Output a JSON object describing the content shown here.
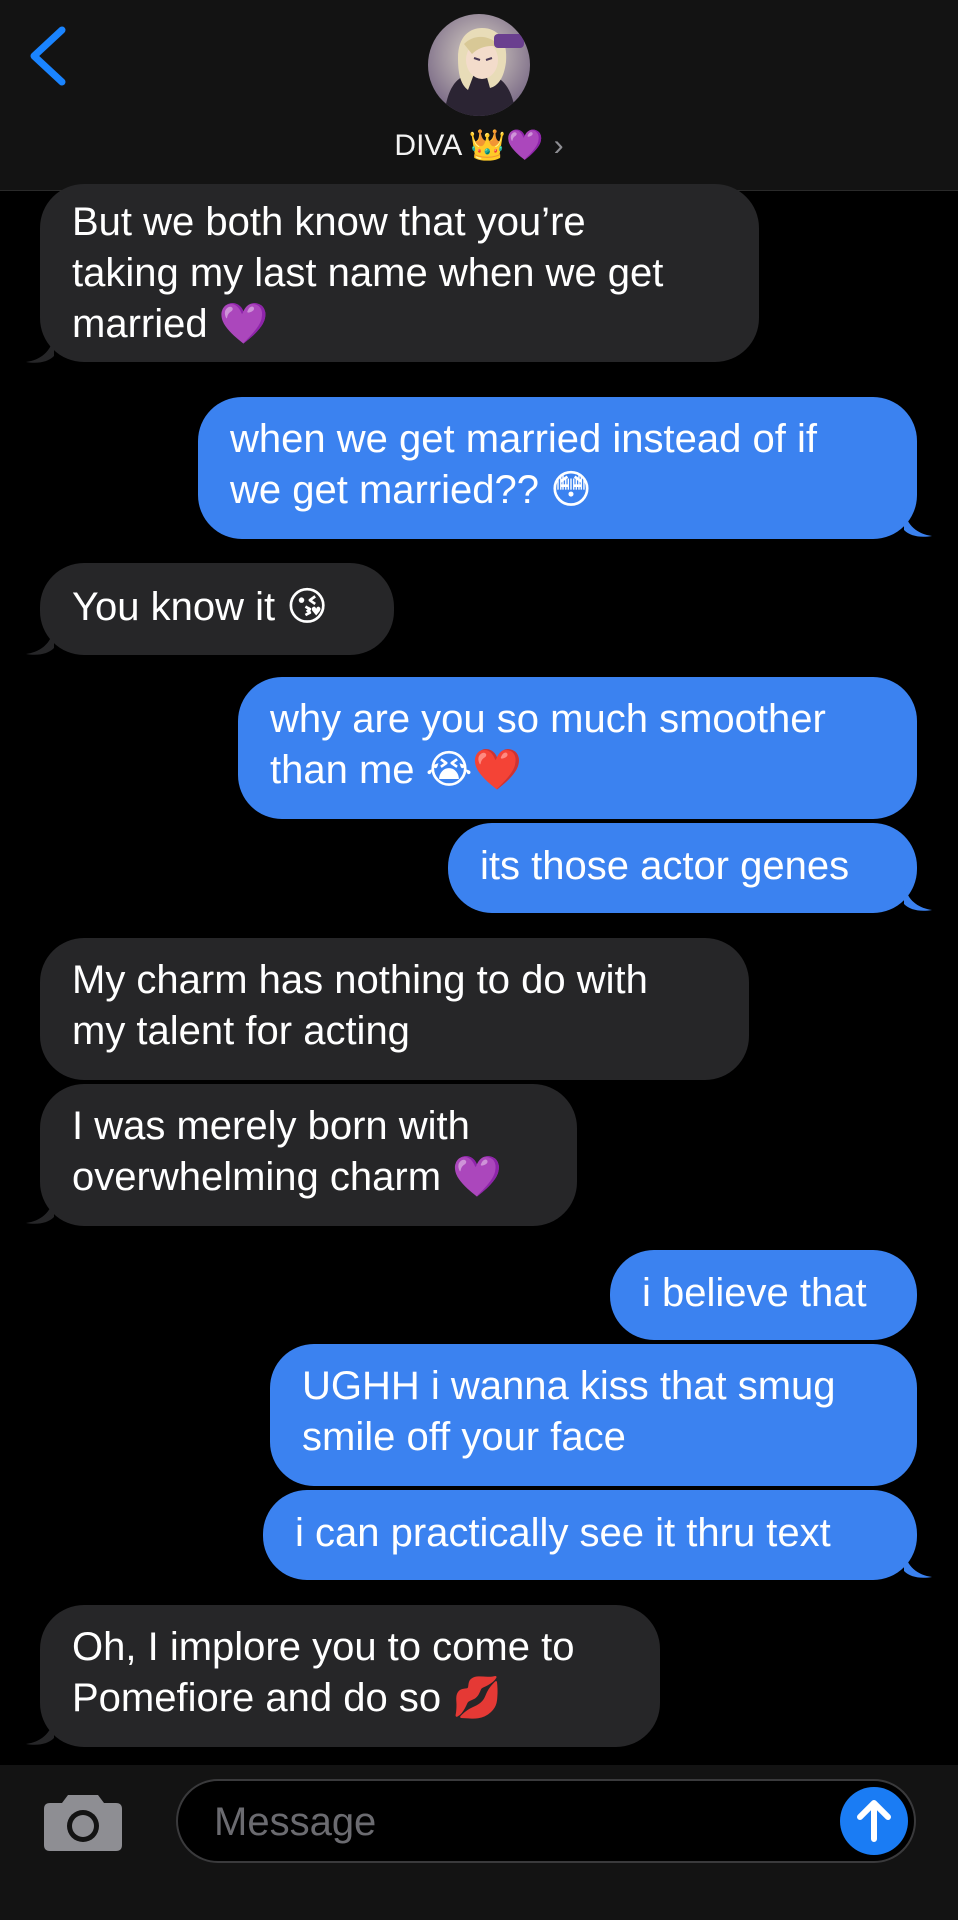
{
  "header": {
    "contact_name": "DIVA 👑💜",
    "chevron": "›",
    "back_icon": "chevron-left-icon"
  },
  "messages": [
    {
      "side": "in",
      "lines": [
        "But we both know that you’re",
        "taking my last name when we get",
        "married 💜"
      ]
    },
    {
      "side": "out",
      "lines": [
        "when we get married instead of if",
        "we get married?? 😳"
      ]
    },
    {
      "side": "in",
      "lines": [
        "You know it 😘"
      ]
    },
    {
      "side": "out",
      "lines": [
        "why are you so much smoother",
        "than me 😭❤️"
      ]
    },
    {
      "side": "out",
      "lines": [
        "its those actor genes"
      ]
    },
    {
      "side": "in",
      "lines": [
        "My charm has nothing to do with",
        "my talent for acting"
      ]
    },
    {
      "side": "in",
      "lines": [
        "I was merely born with",
        "overwhelming charm 💜"
      ]
    },
    {
      "side": "out",
      "lines": [
        "i believe that"
      ]
    },
    {
      "side": "out",
      "lines": [
        "UGHH i wanna kiss that smug",
        "smile off your face"
      ]
    },
    {
      "side": "out",
      "lines": [
        "i can practically see it thru text"
      ]
    },
    {
      "side": "in",
      "lines": [
        "Oh, I implore you to come to",
        "Pomefiore and do so 💋"
      ]
    }
  ],
  "composer": {
    "placeholder": "Message",
    "camera_icon": "camera-icon",
    "send_icon": "arrow-up-icon"
  },
  "colors": {
    "incoming_bubble": "#262628",
    "outgoing_bubble": "#3b82f0",
    "accent": "#1a7cf4",
    "background": "#000000"
  }
}
